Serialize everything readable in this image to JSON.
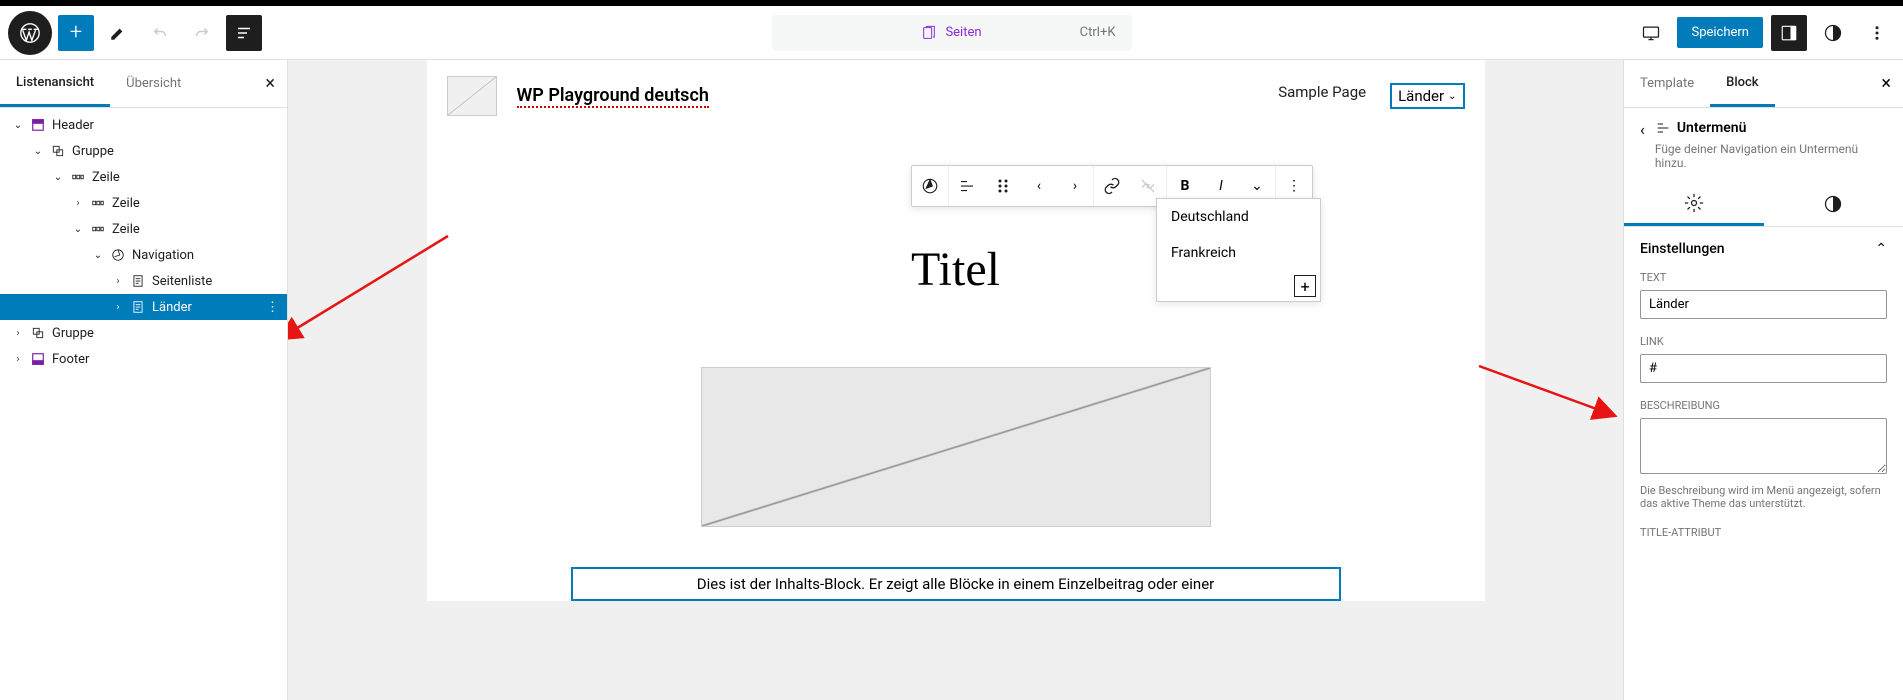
{
  "topbar": {
    "command_label": "Seiten",
    "command_shortcut": "Ctrl+K",
    "save_label": "Speichern"
  },
  "left_panel": {
    "tab_list": "Listenansicht",
    "tab_overview": "Übersicht",
    "tree": {
      "header": "Header",
      "group1": "Gruppe",
      "row1": "Zeile",
      "row1_1": "Zeile",
      "row1_2": "Zeile",
      "navigation": "Navigation",
      "pagelist": "Seitenliste",
      "countries": "Länder",
      "group2": "Gruppe",
      "footer": "Footer"
    }
  },
  "canvas": {
    "site_title": "WP Playground deutsch",
    "nav_sample": "Sample Page",
    "nav_countries": "Länder",
    "dropdown": {
      "germany": "Deutschland",
      "france": "Frankreich"
    },
    "page_title": "Titel",
    "content_text": "Dies ist der Inhalts-Block. Er zeigt alle Blöcke in einem Einzelbeitrag oder einer"
  },
  "right_panel": {
    "tab_template": "Template",
    "tab_block": "Block",
    "block_title": "Untermenü",
    "block_desc": "Füge deiner Navigation ein Untermenü hinzu.",
    "settings_header": "Einstellungen",
    "text_label": "TEXT",
    "text_value": "Länder",
    "link_label": "LINK",
    "link_value": "#",
    "desc_label": "BESCHREIBUNG",
    "desc_help": "Die Beschreibung wird im Menü angezeigt, sofern das aktive Theme das unterstützt.",
    "titleattr_label": "TITLE-ATTRIBUT"
  }
}
